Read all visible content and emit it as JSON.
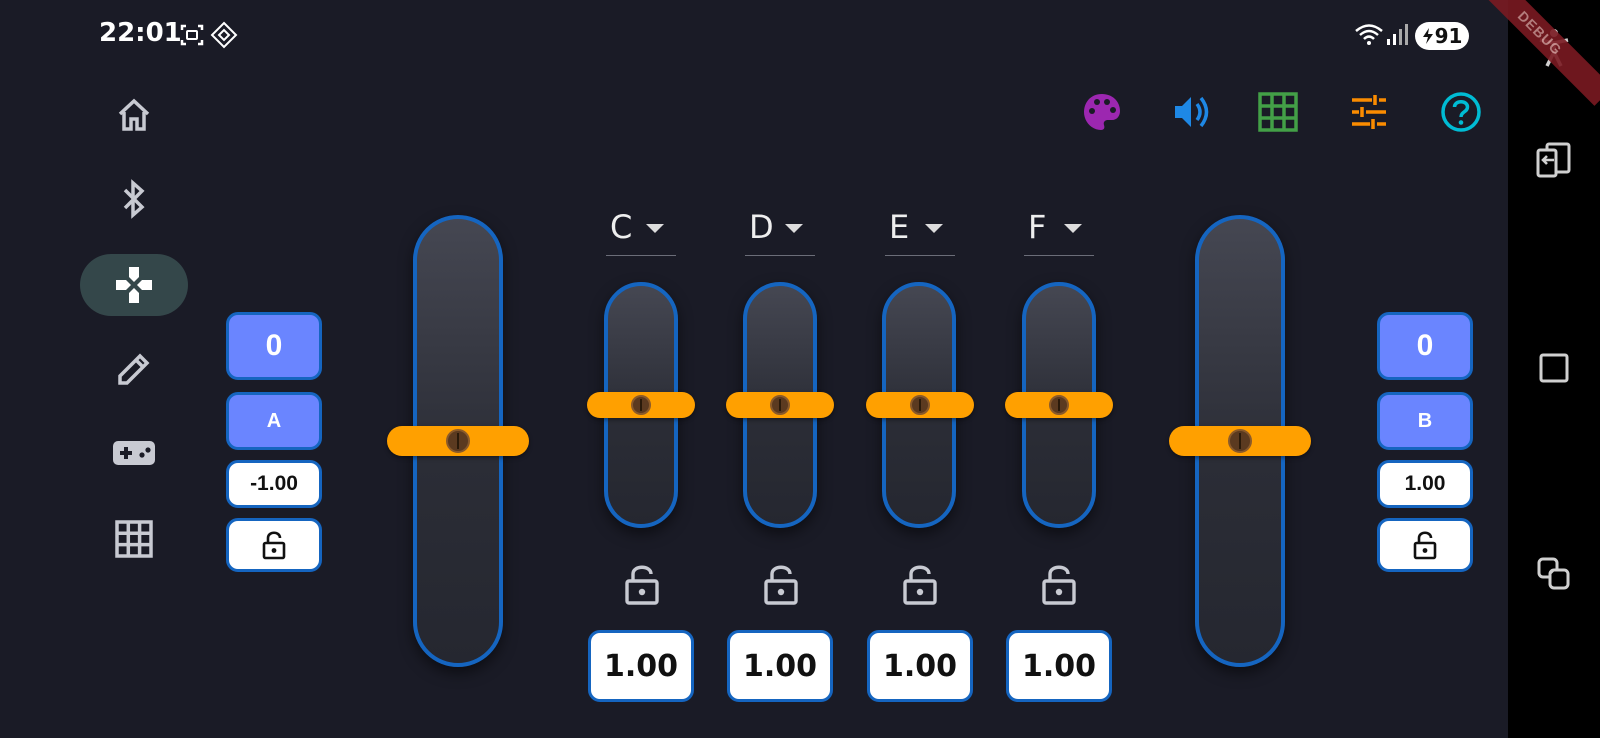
{
  "status_bar": {
    "time": "22:01",
    "battery": "91",
    "icons": [
      "screenshot-icon",
      "nfc-icon",
      "wifi-icon",
      "signal-icon",
      "battery-charging-icon"
    ],
    "debug_banner": "DEBUG"
  },
  "nav_rail": {
    "items": [
      {
        "icon": "home-icon",
        "active": false
      },
      {
        "icon": "bluetooth-icon",
        "active": false
      },
      {
        "icon": "gamepad-cross-icon",
        "active": true
      },
      {
        "icon": "pencil-icon",
        "active": false
      },
      {
        "icon": "game-controller-icon",
        "active": false
      },
      {
        "icon": "grid-icon",
        "active": false
      }
    ]
  },
  "toolbar": {
    "items": [
      {
        "icon": "palette-icon",
        "color": "#9c27b0"
      },
      {
        "icon": "volume-icon",
        "color": "#1e88e5"
      },
      {
        "icon": "grid-icon",
        "color": "#43a047"
      },
      {
        "icon": "tune-icon",
        "color": "#fb8c00"
      },
      {
        "icon": "help-icon",
        "color": "#00bcd4"
      }
    ]
  },
  "left_panel": {
    "counter": "0",
    "axis_name": "A",
    "value": "-1.00",
    "lock_icon": "lock-open-icon"
  },
  "right_panel": {
    "counter": "0",
    "axis_name": "B",
    "value": "1.00",
    "lock_icon": "lock-open-icon"
  },
  "big_sliders": [
    {
      "id": "A",
      "level": 0.5
    },
    {
      "id": "B",
      "level": 0.5
    }
  ],
  "channels": [
    {
      "label": "C",
      "value": "1.00",
      "level": 0.5
    },
    {
      "label": "D",
      "value": "1.00",
      "level": 0.5
    },
    {
      "label": "E",
      "value": "1.00",
      "level": 0.5
    },
    {
      "label": "F",
      "value": "1.00",
      "level": 0.5
    }
  ],
  "colors": {
    "background": "#1a1b26",
    "accent_blue": "#1565c0",
    "button_blue": "#6a85ff",
    "thumb_orange": "#ffa000"
  },
  "system_nav": [
    "accessibility-icon",
    "back-icon",
    "home-square-icon",
    "recents-icon"
  ]
}
